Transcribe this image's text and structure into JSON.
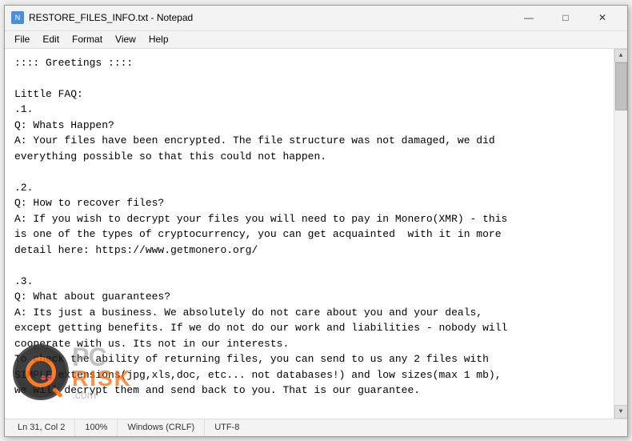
{
  "window": {
    "title": "RESTORE_FILES_INFO.txt - Notepad",
    "icon_label": "N"
  },
  "title_bar_buttons": {
    "minimize": "—",
    "maximize": "□",
    "close": "✕"
  },
  "menu": {
    "items": [
      "File",
      "Edit",
      "Format",
      "View",
      "Help"
    ]
  },
  "content": {
    "text": ":::: Greetings ::::\n\nLittle FAQ:\n.1.\nQ: Whats Happen?\nA: Your files have been encrypted. The file structure was not damaged, we did\neverything possible so that this could not happen.\n\n.2.\nQ: How to recover files?\nA: If you wish to decrypt your files you will need to pay in Monero(XMR) - this\nis one of the types of cryptocurrency, you can get acquainted  with it in more\ndetail here: https://www.getmonero.org/\n\n.3.\nQ: What about guarantees?\nA: Its just a business. We absolutely do not care about you and your deals,\nexcept getting benefits. If we do not do our work and liabilities - nobody will\ncooperate with us. Its not in our interests.\nTo check the ability of returning files, you can send to us any 2 files with\nSIMPLE extensions(jpg,xls,doc, etc... not databases!) and low sizes(max 1 mb),\nwe will decrypt them and send back to you. That is our guarantee."
  },
  "status_bar": {
    "position": "Ln 31, Col 2",
    "zoom": "100%",
    "line_ending": "Windows (CRLF)",
    "encoding": "UTF-8"
  },
  "watermark": {
    "pc_text": "PC",
    "risk_text": "RISK",
    "com_text": ".com"
  }
}
